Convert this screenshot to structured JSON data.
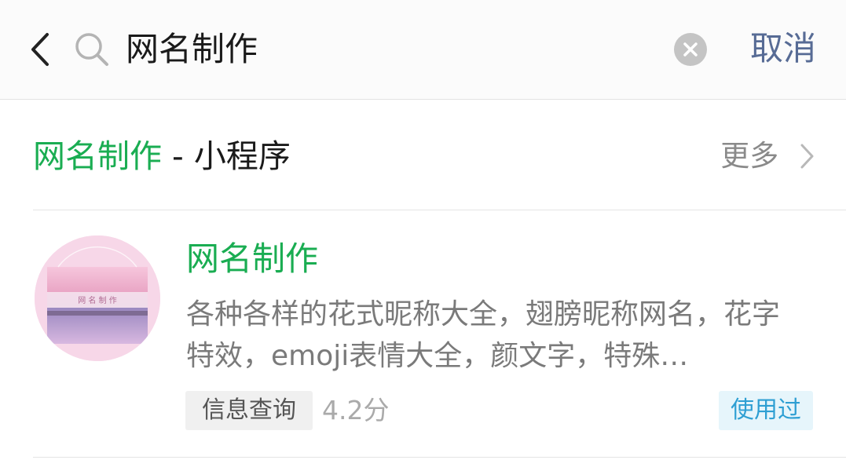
{
  "search": {
    "query": "网名制作",
    "cancel_label": "取消"
  },
  "icons": {
    "back": "chevron-left-icon",
    "search": "magnifier-icon",
    "clear": "clear-circle-x-icon",
    "more": "chevron-right-icon"
  },
  "section": {
    "title_highlight": "网名制作",
    "title_rest": " - 小程序",
    "more_label": "更多"
  },
  "result": {
    "name": "网名制作",
    "icon_caption": "网 名 制 作",
    "description": "各种各样的花式昵称大全，翅膀昵称网名，花字特效，emoji表情大全，颜文字，特殊…",
    "category": "信息查询",
    "rating": "4.2分",
    "used_badge": "使用过"
  },
  "colors": {
    "highlight_green": "#1aad52",
    "link_blue": "#576b95",
    "badge_blue": "#2e9fd3",
    "badge_bg": "#e6f5fb",
    "text_gray": "#7a7a7a"
  }
}
